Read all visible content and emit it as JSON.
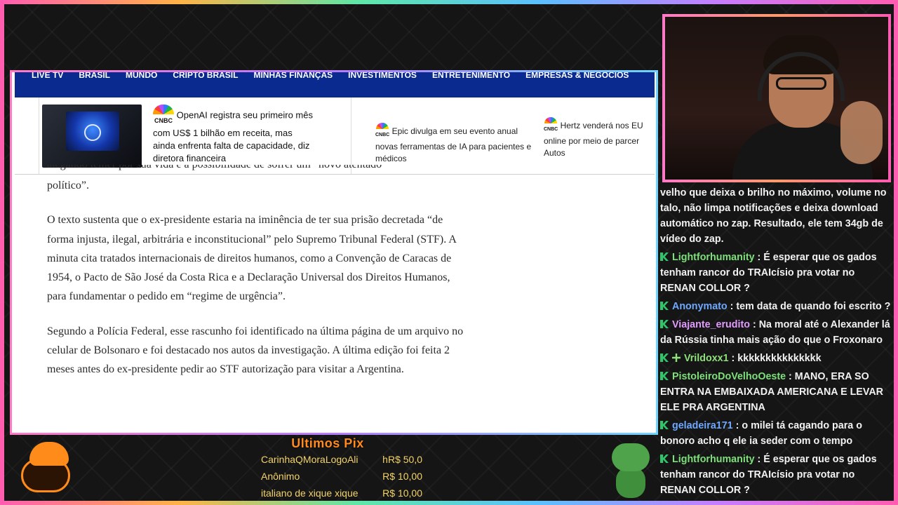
{
  "nav": {
    "items": [
      "LIVE TV",
      "BRASIL",
      "MUNDO",
      "CRIPTO BRASIL",
      "MINHAS FINANÇAS",
      "INVESTIMENTOS",
      "ENTRETENIMENTO",
      "EMPRESAS & NEGÓCIOS"
    ]
  },
  "news": {
    "source_label": "CNBC",
    "items": [
      {
        "text": "OpenAI registra seu primeiro mês com US$ 1 bilhão em receita, mas ainda enfrenta falta de capacidade, diz diretora financeira"
      },
      {
        "text": "Epic divulga em seu evento anual novas ferramentas de IA para pacientes e médicos"
      },
      {
        "text_line1": "Hertz venderá nos EU",
        "text_line2": "online por meio de parcer",
        "text_line3": "Autos"
      }
    ]
  },
  "article": {
    "cut_line": "alegando temer por sua vida e a possibilidade de sofrer um “novo atentado",
    "paragraphs": [
      "político”.",
      "O texto sustenta que o ex-presidente estaria na iminência de ter sua prisão decretada “de forma injusta, ilegal, arbitrária e inconstitucional” pelo Supremo Tribunal Federal (STF). A minuta cita tratados internacionais de direitos humanos, como a Convenção de Caracas de 1954, o Pacto de São José da Costa Rica e a Declaração Universal dos Direitos Humanos, para fundamentar o pedido em “regime de urgência”.",
      "Segundo a Polícia Federal, esse rascunho foi identificado na última página de um arquivo no celular de Bolsonaro e foi destacado nos autos da investigação. A última edição foi feita 2 meses antes do ex-presidente pedir ao STF autorização para visitar a Argentina."
    ]
  },
  "chat": {
    "first_text": "velho que deixa o brilho no máximo, volume no talo, não limpa notificações e deixa download automático no zap. Resultado, ele tem 34gb de vídeo do zap.",
    "messages": [
      {
        "user": "Lightforhumanity",
        "color": "#7de07a",
        "text": "É esperar que os gados tenham rancor do TRAIcísio pra votar no RENAN COLLOR ?"
      },
      {
        "user": "Anonymato",
        "color": "#6ea8ff",
        "text": "tem data de quando foi escrito ?"
      },
      {
        "user": "Viajante_erudito",
        "color": "#e29bff",
        "text": "Na moral até o Alexander lá da Rússia tinha mais ação do que o Froxonaro"
      },
      {
        "user": "Vrildoxx1",
        "color": "#8de07a",
        "text": "kkkkkkkkkkkkkkk"
      },
      {
        "user": "PistoleiroDoVelhoOeste",
        "color": "#7de07a",
        "text": "MANO, ERA SO ENTRA NA EMBAIXADA AMERICANA E LEVAR ELE PRA ARGENTINA"
      },
      {
        "user": "geladeira171",
        "color": "#6ea8ff",
        "text": "o milei tá cagando para o bonoro acho q ele ia seder com o tempo"
      },
      {
        "user": "Lightforhumanity",
        "color": "#7de07a",
        "text": "É esperar que os gados tenham rancor do TRAIcísio pra votar no RENAN COLLOR ?"
      }
    ]
  },
  "pix": {
    "title": "Ultimos Pix",
    "rows": [
      {
        "name": "CarinhaQMoraLogoAli",
        "value": "hR$ 50,0"
      },
      {
        "name": "Anônimo",
        "value": "R$ 10,00"
      },
      {
        "name": "italiano de xique xique",
        "value": "R$ 10,00"
      }
    ]
  }
}
